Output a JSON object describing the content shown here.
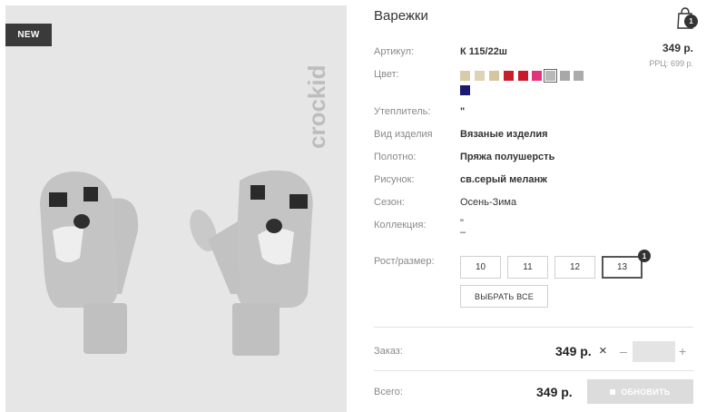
{
  "product": {
    "title": "Варежки",
    "badge": "NEW",
    "brand": "crockid"
  },
  "cart": {
    "count": "1",
    "icon": "shopping-bag-icon"
  },
  "details": {
    "article_label": "Артикул:",
    "article_value": "К 115/22ш",
    "color_label": "Цвет:",
    "insulation_label": "Утеплитель:",
    "insulation_value": "\"",
    "type_label": "Вид изделия",
    "type_value": "Вязаные изделия",
    "fabric_label": "Полотно:",
    "fabric_value": "Пряжа полушерсть",
    "pattern_label": "Рисунок:",
    "pattern_value": "св.серый меланж",
    "season_label": "Сезон:",
    "season_value": "Осень-Зима",
    "collection_label": "Коллекция:",
    "collection_value": "\"",
    "collection_value2": "–",
    "size_label": "Рост/размер:"
  },
  "price": {
    "main": "349 р.",
    "rrp": "РРЦ: 699 р."
  },
  "colors": [
    {
      "hex": "#d8cba8",
      "selected": false
    },
    {
      "hex": "#dfd3b6",
      "selected": false
    },
    {
      "hex": "#d5c6a0",
      "selected": false
    },
    {
      "hex": "#c8202a",
      "selected": false
    },
    {
      "hex": "#c91a2c",
      "selected": false
    },
    {
      "hex": "#e0357b",
      "selected": false
    },
    {
      "hex": "#b8b8b8",
      "selected": true
    },
    {
      "hex": "#a8a8a8",
      "selected": false
    },
    {
      "hex": "#ababab",
      "selected": false
    },
    {
      "hex": "#1c1a6e",
      "selected": false
    }
  ],
  "sizes": [
    {
      "label": "10",
      "active": false
    },
    {
      "label": "11",
      "active": false
    },
    {
      "label": "12",
      "active": false
    },
    {
      "label": "13",
      "active": true
    }
  ],
  "size_selected_count": "1",
  "select_all_label": "ВЫБРАТЬ ВСЕ",
  "order": {
    "label": "Заказ:",
    "price": "349 р.",
    "times": "×",
    "minus": "–",
    "plus": "+",
    "quantity": ""
  },
  "total": {
    "label": "Всего:",
    "price": "349 р.",
    "update_label": "ОБНОВИТЬ"
  }
}
